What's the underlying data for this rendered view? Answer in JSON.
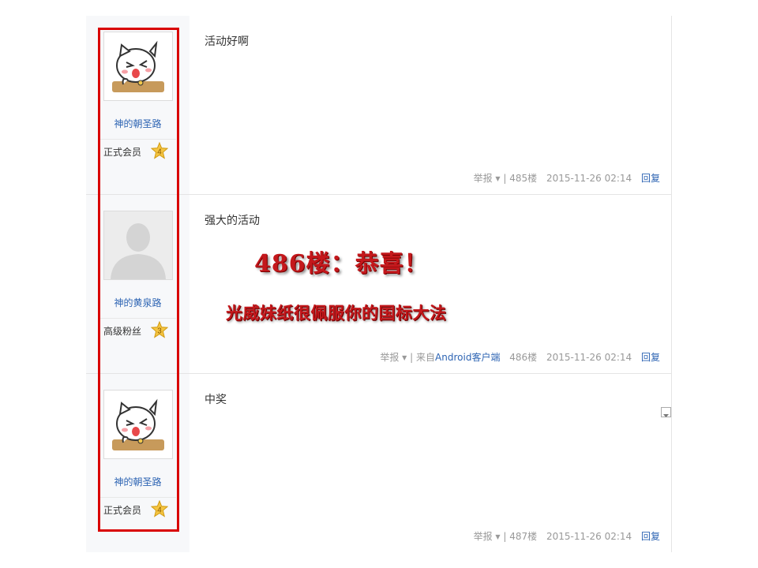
{
  "posts": [
    {
      "username": "神的朝圣路",
      "level_name": "正式会员",
      "level_num": "4",
      "avatar": "cat-sticker-avatar",
      "content": "活动好啊",
      "report": "举报",
      "floor": "485楼",
      "datetime": "2015-11-26 02:14",
      "reply": "回复"
    },
    {
      "username": "神的黄泉路",
      "level_name": "高级粉丝",
      "level_num": "3",
      "avatar": "default-person-avatar",
      "content": "强大的活动",
      "image_line1": "486楼：恭喜！",
      "image_line2": "光威妹纸很佩服你的国标大法",
      "report": "举报",
      "source_prefix": "来自",
      "source_link": "Android客户端",
      "floor": "486楼",
      "datetime": "2015-11-26 02:14",
      "reply": "回复"
    },
    {
      "username": "神的朝圣路",
      "level_name": "正式会员",
      "level_num": "4",
      "avatar": "cat-sticker-avatar",
      "content": "中奖",
      "report": "举报",
      "floor": "487楼",
      "datetime": "2015-11-26 02:14",
      "reply": "回复"
    }
  ],
  "colors": {
    "link": "#2d64b3",
    "highlight_box": "#d90000",
    "image_text": "#c4181c",
    "star": "#f5c542"
  }
}
